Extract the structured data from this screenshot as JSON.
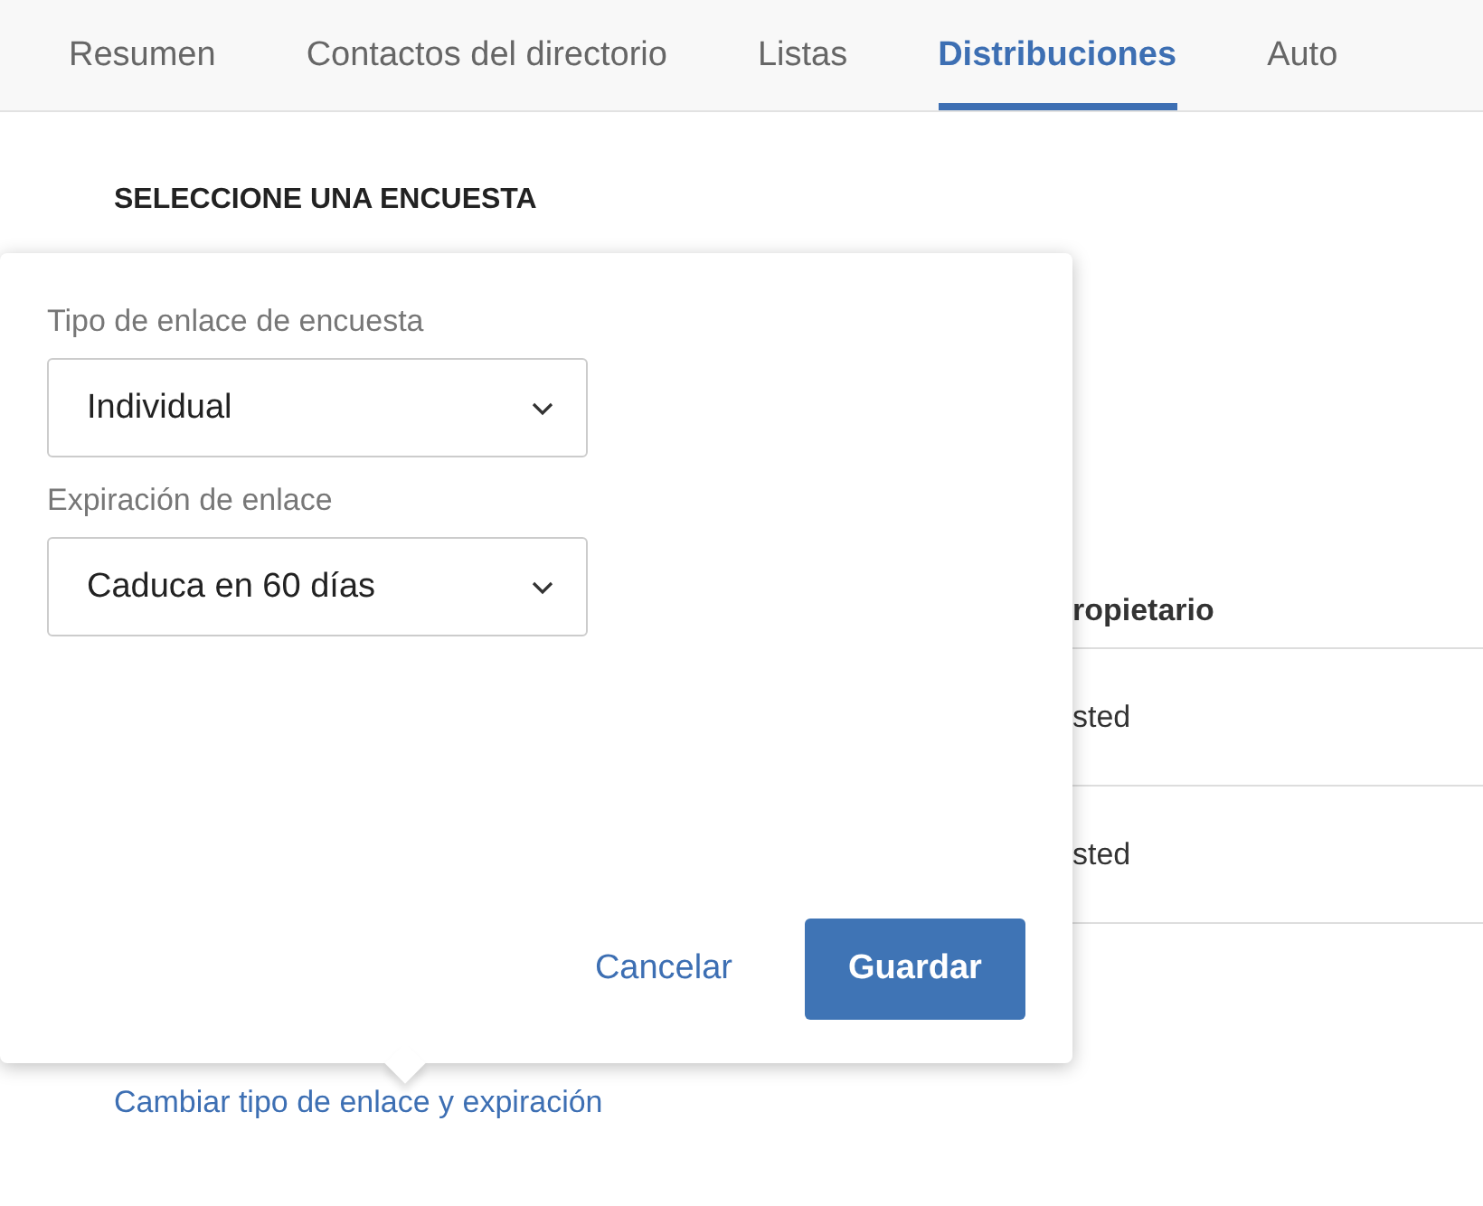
{
  "tabs": [
    {
      "label": "Resumen",
      "selected": false
    },
    {
      "label": "Contactos del directorio",
      "selected": false
    },
    {
      "label": "Listas",
      "selected": false
    },
    {
      "label": "Distribuciones",
      "selected": true
    },
    {
      "label": "Auto",
      "selected": false
    }
  ],
  "section_heading": "SELECCIONE UNA ENCUESTA",
  "table": {
    "header": "ropietario",
    "rows": [
      "sted",
      "sted"
    ]
  },
  "popover": {
    "fields": [
      {
        "label": "Tipo de enlace de encuesta",
        "value": "Individual"
      },
      {
        "label": "Expiración de enlace",
        "value": "Caduca en 60 días"
      }
    ],
    "cancel": "Cancelar",
    "save": "Guardar"
  },
  "change_link": "Cambiar tipo de enlace y expiración"
}
